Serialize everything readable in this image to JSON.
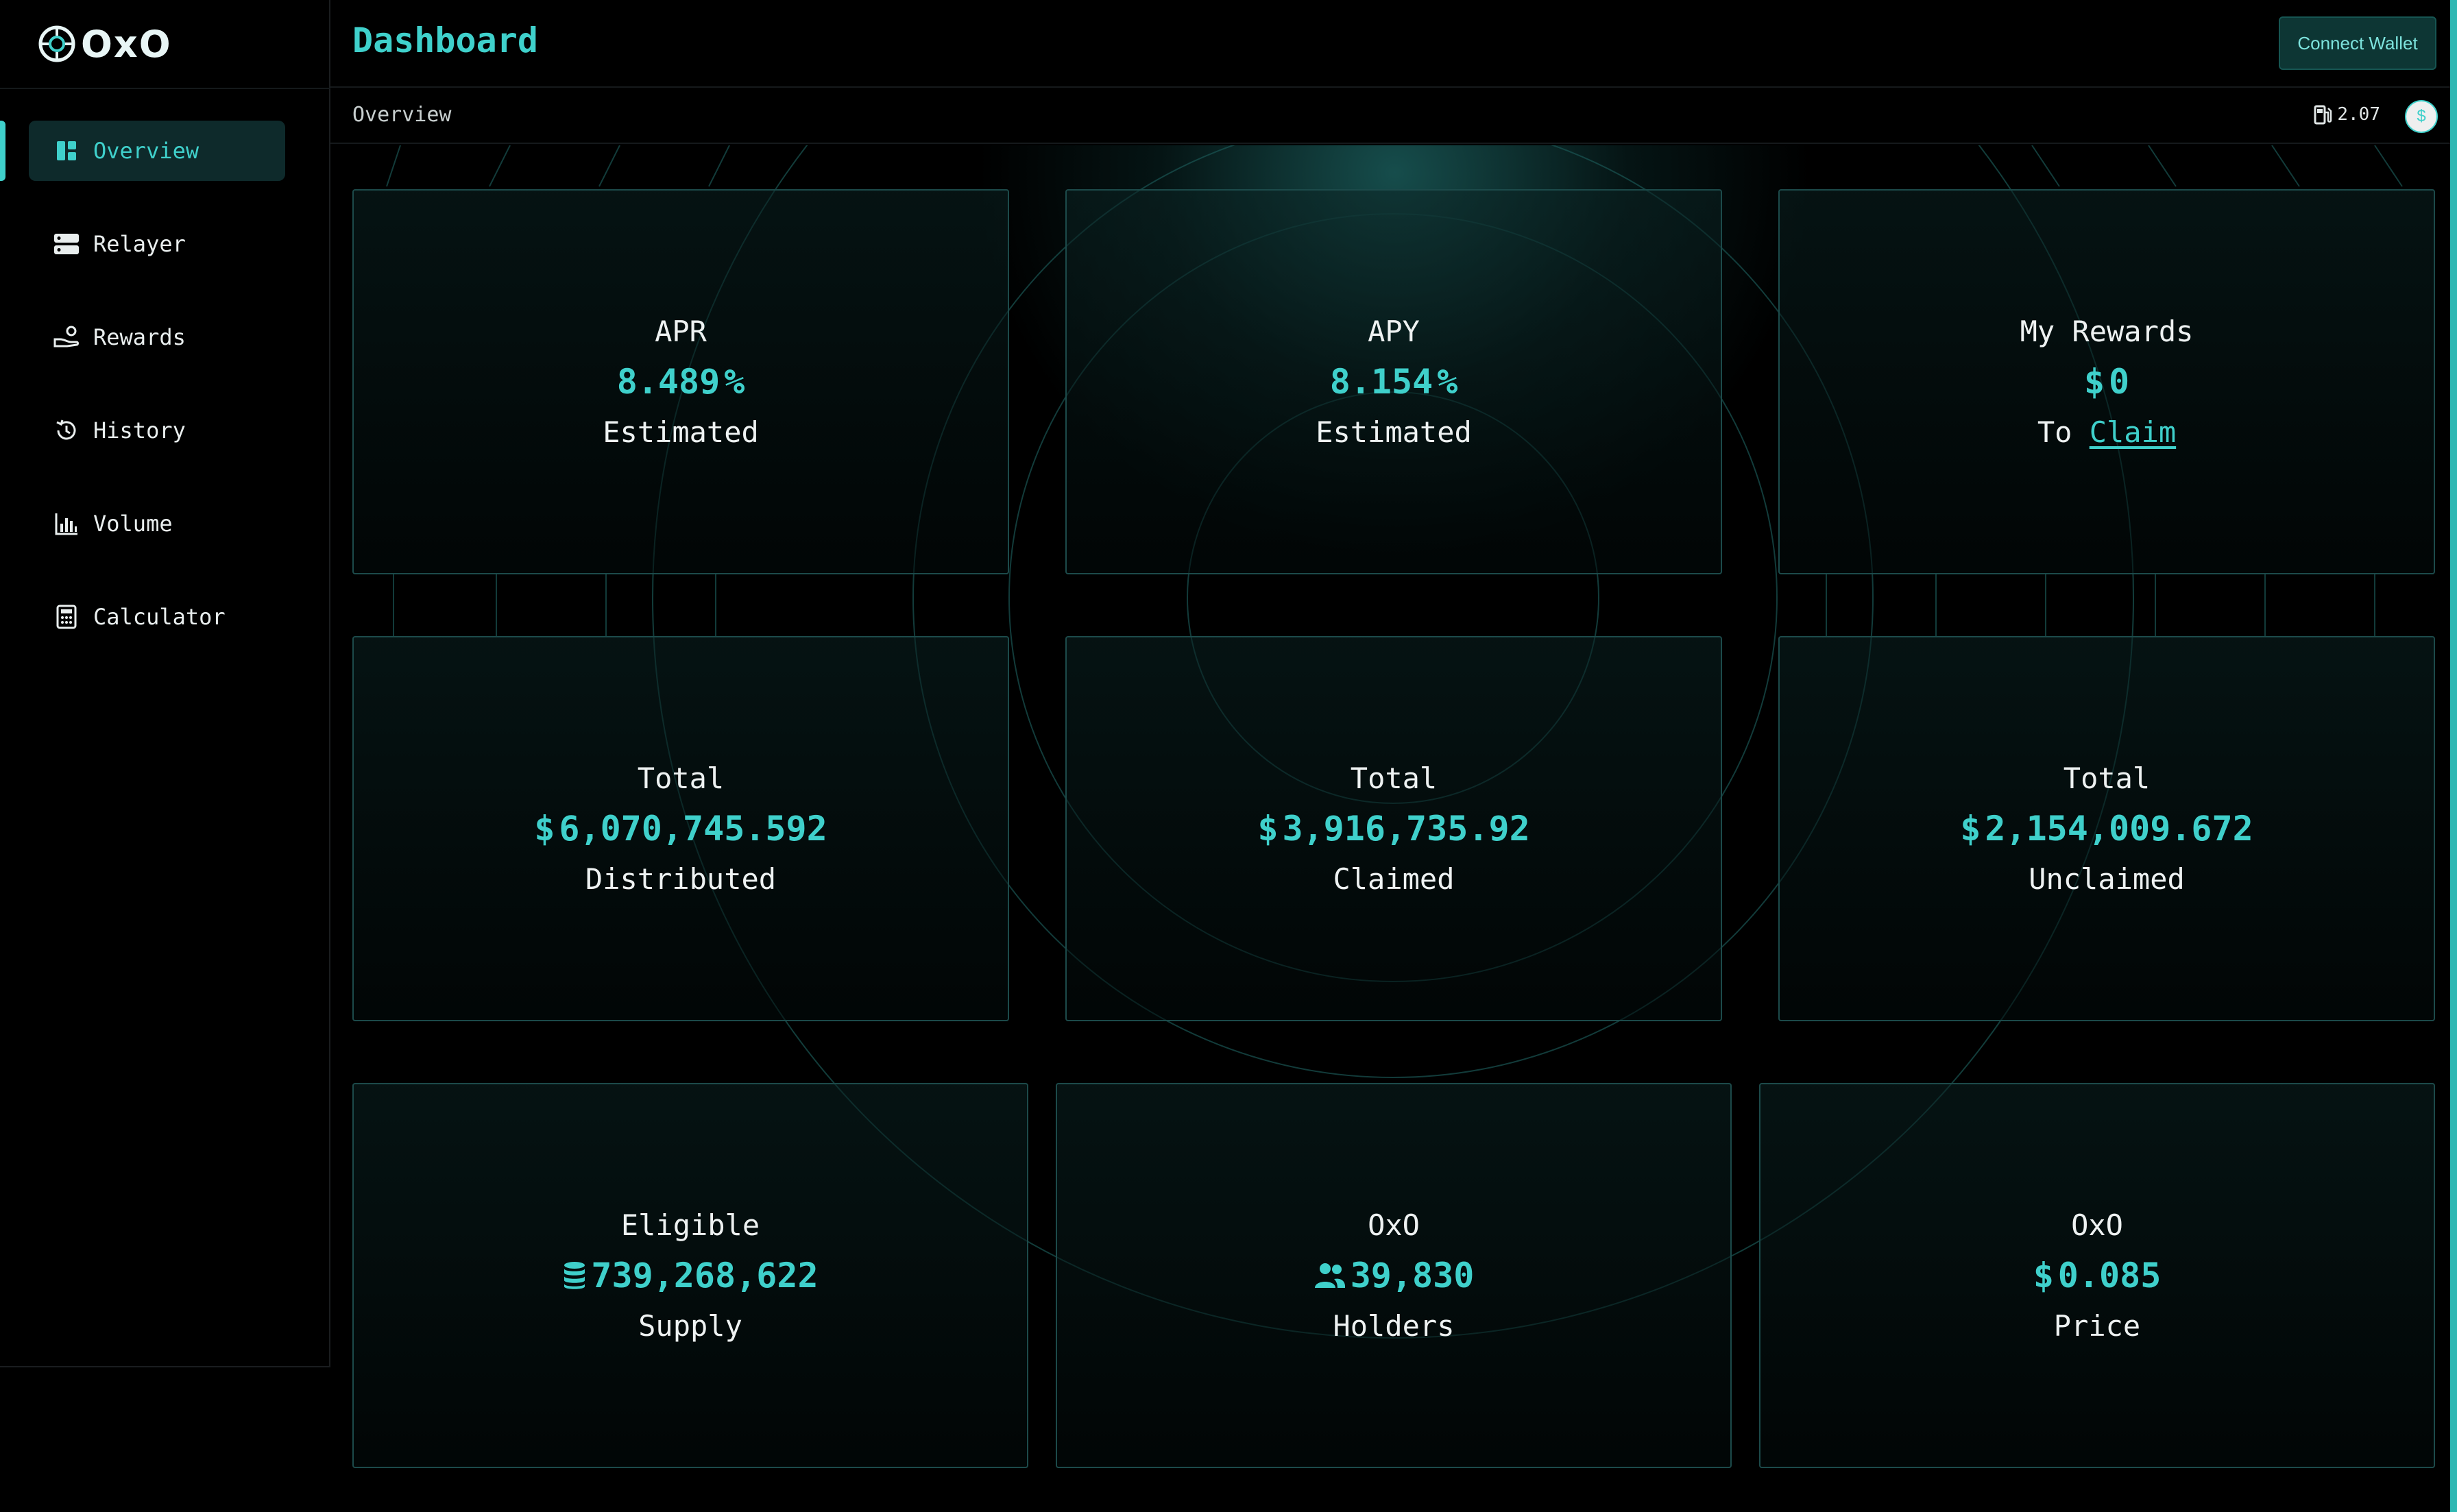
{
  "app": {
    "logo_text": "OxO",
    "logo_icon": "brain-gear-icon"
  },
  "sidebar": {
    "items": [
      {
        "label": "Overview",
        "icon": "dashboard-icon",
        "active": true
      },
      {
        "label": "Relayer",
        "icon": "server-icon",
        "active": false
      },
      {
        "label": "Rewards",
        "icon": "hand-coin-icon",
        "active": false
      },
      {
        "label": "History",
        "icon": "history-icon",
        "active": false
      },
      {
        "label": "Volume",
        "icon": "bar-chart-icon",
        "active": false
      },
      {
        "label": "Calculator",
        "icon": "calculator-icon",
        "active": false
      }
    ]
  },
  "header": {
    "title": "Dashboard",
    "connect_label": "Connect Wallet"
  },
  "subheader": {
    "breadcrumb": "Overview",
    "gas_value": "2.07",
    "gas_icon": "fuel-pump-icon",
    "currency_symbol": "$"
  },
  "cards": [
    {
      "top": "APR",
      "value": "8.489",
      "prefix": "",
      "suffix": "%",
      "bottom": "Estimated"
    },
    {
      "top": "APY",
      "value": "8.154",
      "prefix": "",
      "suffix": "%",
      "bottom": "Estimated"
    },
    {
      "top": "My Rewards",
      "value": "0",
      "prefix": "$",
      "suffix": "",
      "bottom_prefix": "To",
      "bottom_link": "Claim"
    },
    {
      "top": "Total",
      "value": "6,070,745.592",
      "prefix": "$",
      "suffix": "",
      "bottom": "Distributed"
    },
    {
      "top": "Total",
      "value": "3,916,735.92",
      "prefix": "$",
      "suffix": "",
      "bottom": "Claimed"
    },
    {
      "top": "Total",
      "value": "2,154,009.672",
      "prefix": "$",
      "suffix": "",
      "bottom": "Unclaimed"
    },
    {
      "top": "Eligible",
      "value": "739,268,622",
      "icon": "coin-stack-icon",
      "bottom": "Supply"
    },
    {
      "top": "OxO",
      "value": "39,830",
      "icon": "users-icon",
      "bottom": "Holders"
    },
    {
      "top": "OxO",
      "value": "0.085",
      "prefix": "$",
      "suffix": "",
      "bottom": "Price"
    }
  ],
  "colors": {
    "accent": "#3fd0cb",
    "background": "#000000",
    "card_border": "#1c4a4a",
    "active_nav_bg": "#0e2a2b"
  }
}
